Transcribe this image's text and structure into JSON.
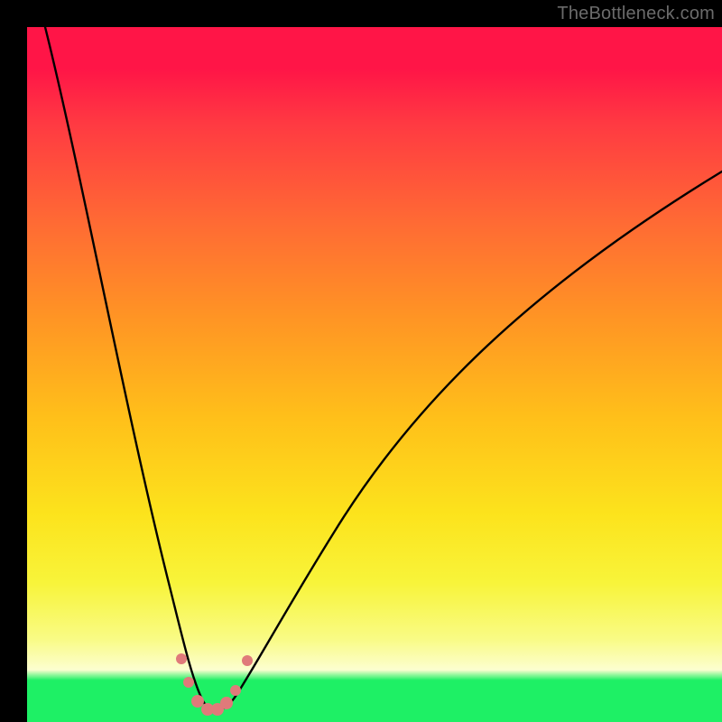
{
  "watermark": "TheBottleneck.com",
  "chart_data": {
    "type": "line",
    "title": "",
    "xlabel": "",
    "ylabel": "",
    "xlim": [
      0,
      100
    ],
    "ylim": [
      0,
      100
    ],
    "grid": false,
    "legend": false,
    "background_gradient": {
      "direction": "vertical",
      "stops": [
        {
          "pos": 0.0,
          "color": "#ff1547"
        },
        {
          "pos": 0.2,
          "color": "#ff4a3a"
        },
        {
          "pos": 0.4,
          "color": "#ff8a28"
        },
        {
          "pos": 0.6,
          "color": "#ffc91c"
        },
        {
          "pos": 0.78,
          "color": "#f7ee30"
        },
        {
          "pos": 0.9,
          "color": "#fbfac0"
        },
        {
          "pos": 0.94,
          "color": "#1ef065"
        },
        {
          "pos": 1.0,
          "color": "#1ef065"
        }
      ]
    },
    "series": [
      {
        "name": "bottleneck-curve",
        "color": "#000000",
        "x": [
          2,
          4,
          6,
          8,
          10,
          12,
          14,
          16,
          18,
          20,
          21,
          22,
          23,
          24,
          25,
          26,
          27,
          28,
          29,
          30,
          32,
          35,
          40,
          45,
          50,
          55,
          60,
          65,
          70,
          75,
          80,
          85,
          90,
          95,
          100
        ],
        "y": [
          100,
          94,
          88,
          82,
          75,
          68,
          60,
          52,
          43,
          33,
          27,
          21,
          14,
          8,
          4,
          2,
          2,
          3,
          5,
          8,
          14,
          23,
          35,
          44,
          51,
          57,
          62,
          66,
          70,
          73,
          76,
          78,
          80,
          82,
          83
        ]
      }
    ],
    "markers": [
      {
        "name": "data-point",
        "x": 21.5,
        "y": 12,
        "r": 6,
        "color": "#e07a7a"
      },
      {
        "name": "data-point",
        "x": 22.5,
        "y": 7,
        "r": 6,
        "color": "#e07a7a"
      },
      {
        "name": "data-point",
        "x": 23.7,
        "y": 3.5,
        "r": 7,
        "color": "#e07a7a"
      },
      {
        "name": "data-point",
        "x": 25.0,
        "y": 2.0,
        "r": 7,
        "color": "#e07a7a"
      },
      {
        "name": "data-point",
        "x": 26.3,
        "y": 2.0,
        "r": 7,
        "color": "#e07a7a"
      },
      {
        "name": "data-point",
        "x": 27.5,
        "y": 3.2,
        "r": 7,
        "color": "#e07a7a"
      },
      {
        "name": "data-point",
        "x": 28.8,
        "y": 5.6,
        "r": 6,
        "color": "#e07a7a"
      },
      {
        "name": "data-point",
        "x": 30.5,
        "y": 11,
        "r": 6,
        "color": "#e07a7a"
      }
    ]
  }
}
